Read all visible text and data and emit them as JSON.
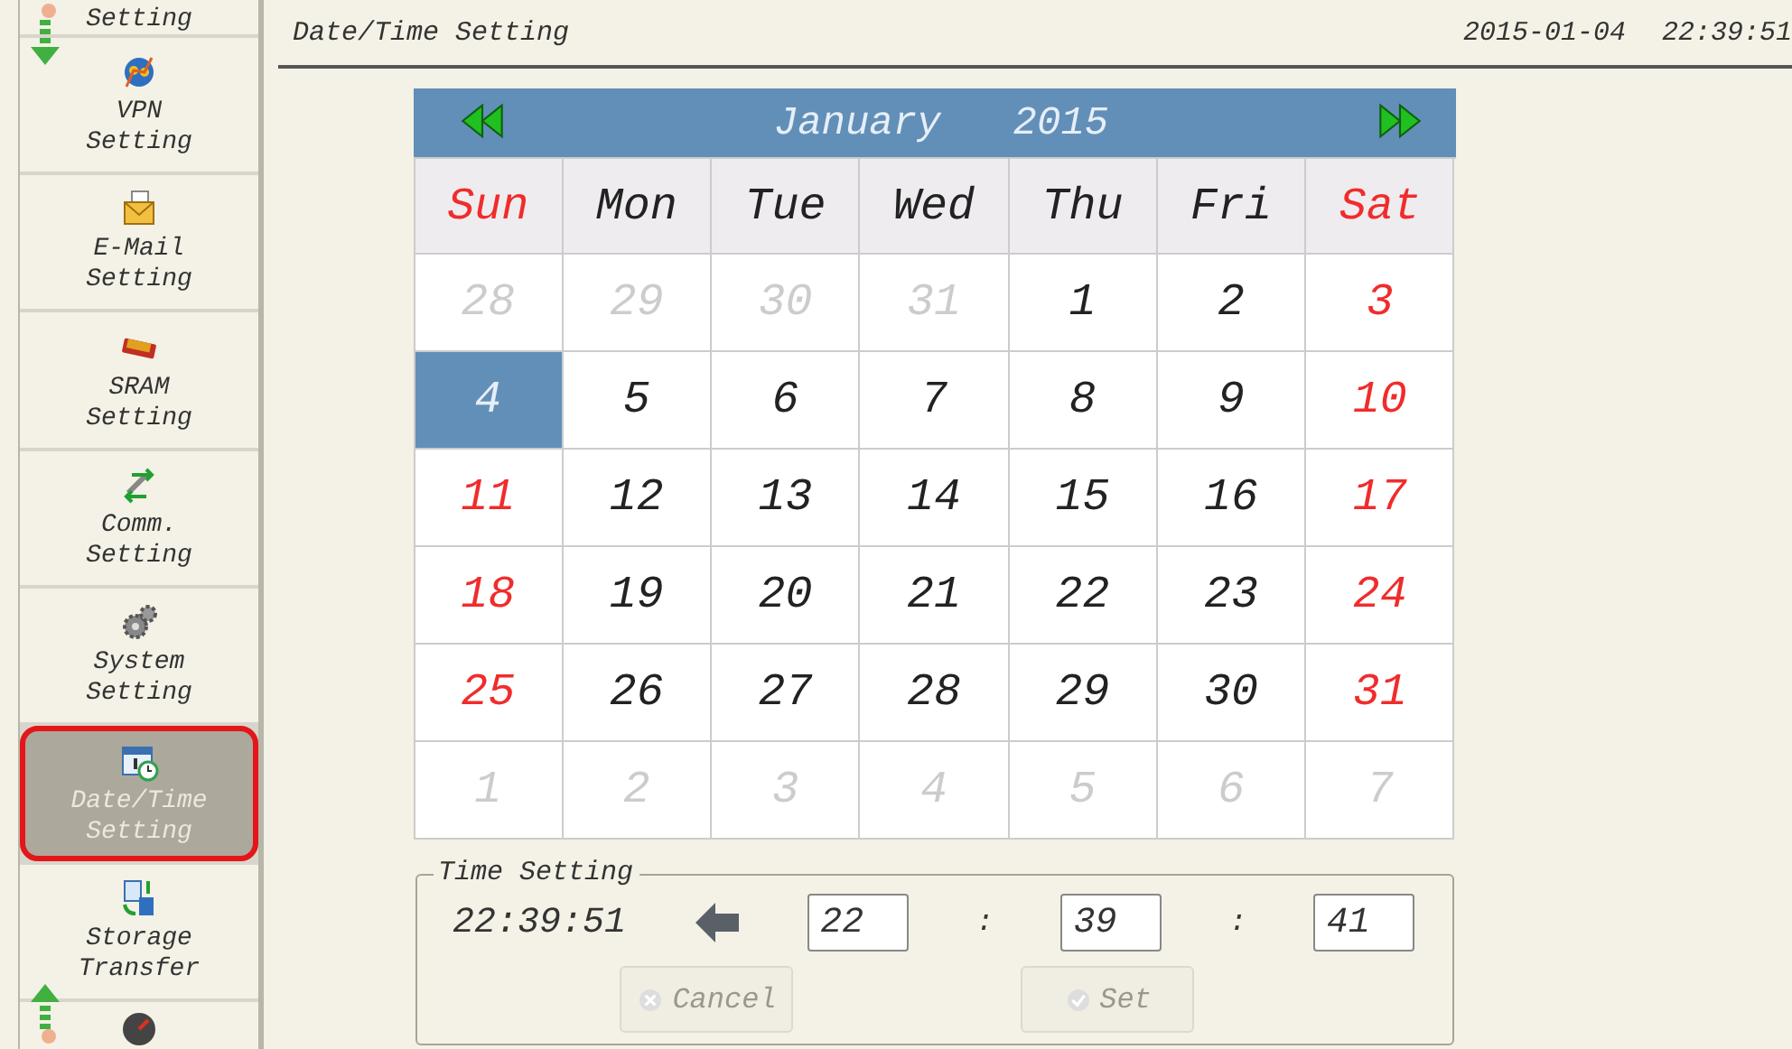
{
  "sidebar": {
    "items": [
      {
        "label": "Setting",
        "selected": false
      },
      {
        "label": "VPN\nSetting",
        "selected": false
      },
      {
        "label": "E-Mail\nSetting",
        "selected": false
      },
      {
        "label": "SRAM\nSetting",
        "selected": false
      },
      {
        "label": "Comm.\nSetting",
        "selected": false
      },
      {
        "label": "System\nSetting",
        "selected": false
      },
      {
        "label": "Date/Time\nSetting",
        "selected": true
      },
      {
        "label": "Storage\nTransfer",
        "selected": false
      },
      {
        "selected": false
      }
    ]
  },
  "header": {
    "title": "Date/Time Setting",
    "date": "2015-01-04",
    "time": "22:39:51"
  },
  "calendar": {
    "month": "January",
    "year": "2015",
    "weekdays": [
      {
        "label": "Sun",
        "kind": "weekend"
      },
      {
        "label": "Mon",
        "kind": "weekday"
      },
      {
        "label": "Tue",
        "kind": "weekday"
      },
      {
        "label": "Wed",
        "kind": "weekday"
      },
      {
        "label": "Thu",
        "kind": "weekday"
      },
      {
        "label": "Fri",
        "kind": "weekday"
      },
      {
        "label": "Sat",
        "kind": "weekend"
      }
    ],
    "weeks": [
      [
        {
          "day": "28",
          "kind": "other",
          "selected": false
        },
        {
          "day": "29",
          "kind": "other",
          "selected": false
        },
        {
          "day": "30",
          "kind": "other",
          "selected": false
        },
        {
          "day": "31",
          "kind": "other",
          "selected": false
        },
        {
          "day": "1",
          "kind": "weekday",
          "selected": false
        },
        {
          "day": "2",
          "kind": "weekday",
          "selected": false
        },
        {
          "day": "3",
          "kind": "weekend",
          "selected": false
        }
      ],
      [
        {
          "day": "4",
          "kind": "weekend",
          "selected": true
        },
        {
          "day": "5",
          "kind": "weekday",
          "selected": false
        },
        {
          "day": "6",
          "kind": "weekday",
          "selected": false
        },
        {
          "day": "7",
          "kind": "weekday",
          "selected": false
        },
        {
          "day": "8",
          "kind": "weekday",
          "selected": false
        },
        {
          "day": "9",
          "kind": "weekday",
          "selected": false
        },
        {
          "day": "10",
          "kind": "weekend",
          "selected": false
        }
      ],
      [
        {
          "day": "11",
          "kind": "weekend",
          "selected": false
        },
        {
          "day": "12",
          "kind": "weekday",
          "selected": false
        },
        {
          "day": "13",
          "kind": "weekday",
          "selected": false
        },
        {
          "day": "14",
          "kind": "weekday",
          "selected": false
        },
        {
          "day": "15",
          "kind": "weekday",
          "selected": false
        },
        {
          "day": "16",
          "kind": "weekday",
          "selected": false
        },
        {
          "day": "17",
          "kind": "weekend",
          "selected": false
        }
      ],
      [
        {
          "day": "18",
          "kind": "weekend",
          "selected": false
        },
        {
          "day": "19",
          "kind": "weekday",
          "selected": false
        },
        {
          "day": "20",
          "kind": "weekday",
          "selected": false
        },
        {
          "day": "21",
          "kind": "weekday",
          "selected": false
        },
        {
          "day": "22",
          "kind": "weekday",
          "selected": false
        },
        {
          "day": "23",
          "kind": "weekday",
          "selected": false
        },
        {
          "day": "24",
          "kind": "weekend",
          "selected": false
        }
      ],
      [
        {
          "day": "25",
          "kind": "weekend",
          "selected": false
        },
        {
          "day": "26",
          "kind": "weekday",
          "selected": false
        },
        {
          "day": "27",
          "kind": "weekday",
          "selected": false
        },
        {
          "day": "28",
          "kind": "weekday",
          "selected": false
        },
        {
          "day": "29",
          "kind": "weekday",
          "selected": false
        },
        {
          "day": "30",
          "kind": "weekday",
          "selected": false
        },
        {
          "day": "31",
          "kind": "weekend",
          "selected": false
        }
      ],
      [
        {
          "day": "1",
          "kind": "other",
          "selected": false
        },
        {
          "day": "2",
          "kind": "other",
          "selected": false
        },
        {
          "day": "3",
          "kind": "other",
          "selected": false
        },
        {
          "day": "4",
          "kind": "other",
          "selected": false
        },
        {
          "day": "5",
          "kind": "other",
          "selected": false
        },
        {
          "day": "6",
          "kind": "other",
          "selected": false
        },
        {
          "day": "7",
          "kind": "other",
          "selected": false
        }
      ]
    ]
  },
  "time_setting": {
    "title": "Time Setting",
    "current": "22:39:51",
    "hour": "22",
    "minute": "39",
    "second": "41",
    "separators": [
      ":",
      ":"
    ],
    "buttons": [
      {
        "label": "Cancel",
        "disabled": true
      },
      {
        "label": "Set",
        "disabled": true
      }
    ]
  }
}
